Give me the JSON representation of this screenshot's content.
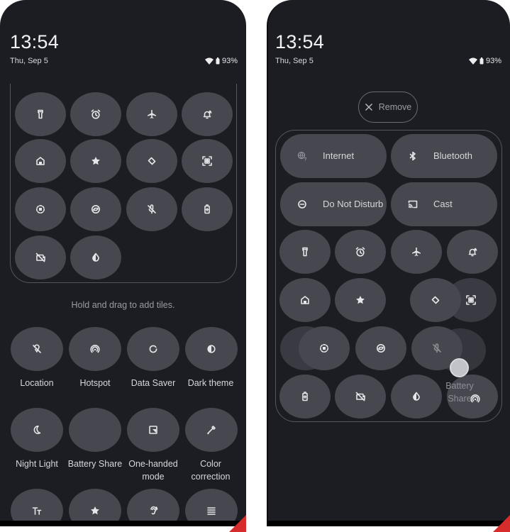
{
  "left_screen": {
    "clock": "13:54",
    "date": "Thu, Sep 5",
    "battery_percent": "93%",
    "active_tiles": [
      {
        "icon": "flashlight-icon"
      },
      {
        "icon": "alarm-icon"
      },
      {
        "icon": "airplane-icon"
      },
      {
        "icon": "bell-ring-icon"
      },
      {
        "icon": "home-icon"
      },
      {
        "icon": "star-icon"
      },
      {
        "icon": "auto-rotate-icon"
      },
      {
        "icon": "qr-scan-icon"
      },
      {
        "icon": "screen-record-icon"
      },
      {
        "icon": "sync-icon"
      },
      {
        "icon": "mic-off-icon"
      },
      {
        "icon": "battery-saver-icon"
      },
      {
        "icon": "camera-off-icon"
      },
      {
        "icon": "invert-colors-icon"
      }
    ],
    "hint": "Hold and drag to add tiles.",
    "available_tiles": [
      {
        "icon": "location-off-icon",
        "label": "Location"
      },
      {
        "icon": "hotspot-icon",
        "label": "Hotspot"
      },
      {
        "icon": "data-saver-icon",
        "label": "Data Saver"
      },
      {
        "icon": "dark-theme-icon",
        "label": "Dark theme"
      },
      {
        "icon": "night-light-icon",
        "label": "Night Light"
      },
      {
        "icon": "none",
        "label": "Battery Share"
      },
      {
        "icon": "one-handed-icon",
        "label": "One-handed mode"
      },
      {
        "icon": "eyedropper-icon",
        "label": "Color correction"
      },
      {
        "icon": "font-size-icon",
        "label": ""
      },
      {
        "icon": "star-icon",
        "label": ""
      },
      {
        "icon": "hearing-icon",
        "label": ""
      },
      {
        "icon": "list-icon",
        "label": ""
      }
    ]
  },
  "right_screen": {
    "clock": "13:54",
    "date": "Thu, Sep 5",
    "battery_percent": "93%",
    "remove_label": "Remove",
    "wide_tiles": [
      {
        "icon": "internet-icon",
        "label": "Internet"
      },
      {
        "icon": "bluetooth-icon",
        "label": "Bluetooth"
      },
      {
        "icon": "do-not-disturb-icon",
        "label": "Do Not Disturb"
      },
      {
        "icon": "cast-icon",
        "label": "Cast"
      }
    ],
    "dragging_tile_label": "Battery Share"
  }
}
